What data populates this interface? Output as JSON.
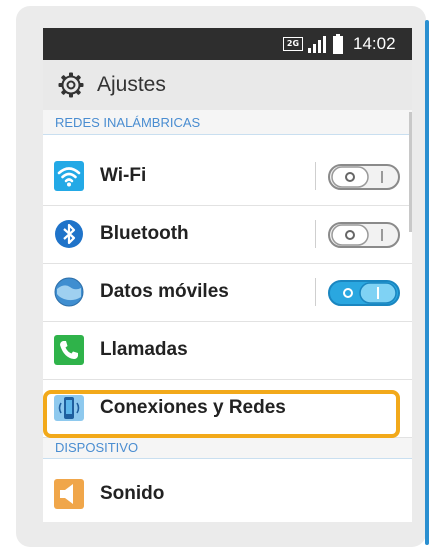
{
  "statusbar": {
    "network": "2G",
    "time": "14:02",
    "icons": [
      "signal-icon",
      "battery-icon"
    ]
  },
  "header": {
    "title": "Ajustes",
    "icon": "gear-icon"
  },
  "sections": {
    "wireless": "REDES INALÁMBRICAS",
    "device": "DISPOSITIVO"
  },
  "rows": {
    "wifi": {
      "label": "Wi-Fi",
      "icon": "wifi-icon",
      "on": false
    },
    "bluetooth": {
      "label": "Bluetooth",
      "icon": "bluetooth-icon",
      "on": false
    },
    "mobile_data": {
      "label": "Datos móviles",
      "icon": "globe-icon",
      "on": true
    },
    "calls": {
      "label": "Llamadas",
      "icon": "phone-icon"
    },
    "connections": {
      "label": "Conexiones y Redes",
      "icon": "connections-icon",
      "highlighted": true
    },
    "sound": {
      "label": "Sonido",
      "icon": "speaker-icon"
    }
  },
  "colors": {
    "accent": "#4a8dd1",
    "toggle_on": "#2aa7e0",
    "highlight": "#f2a91a",
    "frame_accent": "#2a8fd0"
  }
}
